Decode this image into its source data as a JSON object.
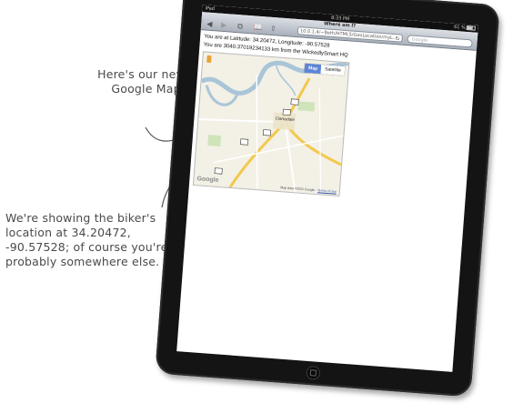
{
  "annotations": {
    "map_note": "Here's our new Google Map!",
    "biker_note": "We're showing the biker's location at 34.20472, -90.57528; of course you're probably somewhere else."
  },
  "status_bar": {
    "carrier": "iPad",
    "time": "8:33 PM",
    "battery": "61 %"
  },
  "browser": {
    "page_title": "Where am I?",
    "url": "10.0.1.4/~Beth/HTML5/GeoLocation/myL...",
    "search_placeholder": "Google",
    "icons": [
      "back-icon",
      "forward-icon",
      "pages-icon",
      "bookmarks-icon",
      "share-icon",
      "reload-icon"
    ]
  },
  "page": {
    "location_text": "You are at Latitude: 34.20472, Longitude: -90.57528",
    "distance_text": "You are 3040.37019234133 km from the WickedlySmart HQ"
  },
  "map": {
    "map_button": "Map",
    "satellite_button": "Satellite",
    "selected": "Map",
    "city": "Clarksdale",
    "google_logo": "Google",
    "map_data": "Map data ©2011 Google",
    "terms": "Terms of Use",
    "colors": {
      "water": "#a9c5d8",
      "highway": "#f2c94c",
      "button_active": "#5c85d6"
    }
  }
}
